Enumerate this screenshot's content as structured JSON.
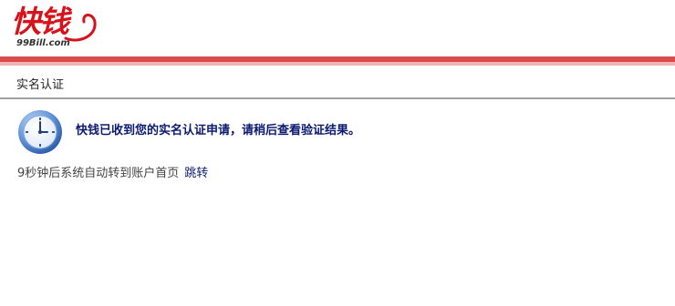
{
  "brand": {
    "logo_text": "快钱",
    "logo_domain": "99Bill.com",
    "primary_color": "#d8111a"
  },
  "section": {
    "title": "实名认证"
  },
  "status": {
    "icon": "clock-icon",
    "message": "快钱已收到您的实名认证申请，请稍后查看验证结果。"
  },
  "redirect": {
    "notice": "9秒钟后系统自动转到账户首页",
    "link_label": "跳转"
  }
}
